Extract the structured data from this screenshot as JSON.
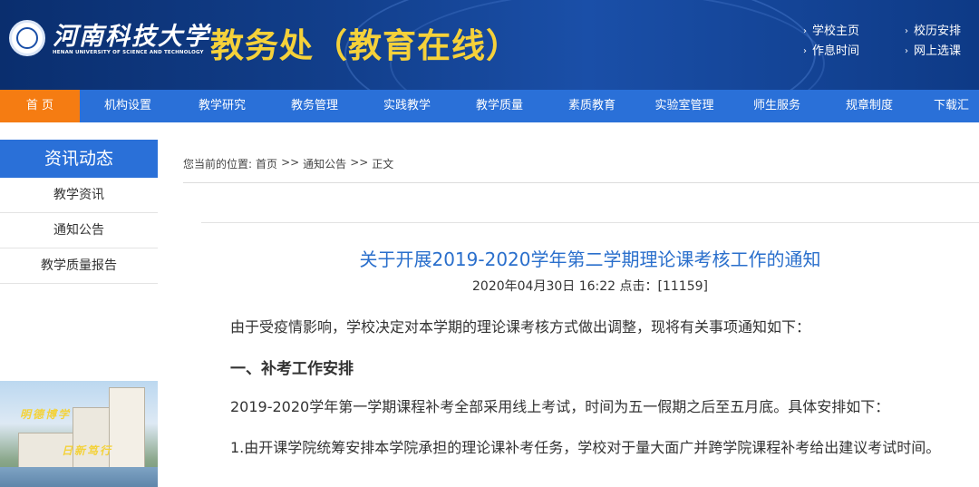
{
  "header": {
    "university_name": "河南科技大学",
    "university_name_en": "HENAN UNIVERSITY OF SCIENCE AND TECHNOLOGY",
    "site_title": "教务处（教育在线）",
    "quick_links": {
      "school_home": "学校主页",
      "calendar": "校历安排",
      "schedule": "作息时间",
      "online_course": "网上选课"
    }
  },
  "nav": {
    "items": [
      "首 页",
      "机构设置",
      "教学研究",
      "教务管理",
      "实践教学",
      "教学质量",
      "素质教育",
      "实验室管理",
      "师生服务",
      "规章制度",
      "下载汇总"
    ],
    "active_index": 0
  },
  "sidebar": {
    "heading": "资讯动态",
    "items": [
      "教学资讯",
      "通知公告",
      "教学质量报告"
    ],
    "banner_text_1": "明德博学",
    "banner_text_2": "日新笃行"
  },
  "breadcrumb": {
    "prefix": "您当前的位置:",
    "home": "首页",
    "sep": ">>",
    "category": "通知公告",
    "current": "正文"
  },
  "article": {
    "title": "关于开展2019-2020学年第二学期理论课考核工作的通知",
    "meta": "2020年04月30日 16:22  点击：[11159]",
    "paragraph_1": "由于受疫情影响，学校决定对本学期的理论课考核方式做出调整，现将有关事项通知如下：",
    "section_1_heading": "一、补考工作安排",
    "paragraph_2": "2019-2020学年第一学期课程补考全部采用线上考试，时间为五一假期之后至五月底。具体安排如下：",
    "paragraph_3": "1.由开课学院统筹安排本学院承担的理论课补考任务，学校对于量大面广并跨学院课程补考给出建议考试时间。"
  },
  "colors": {
    "nav_blue": "#2a70d8",
    "nav_active": "#f57c12",
    "title_blue": "#2a6fcc",
    "header_gold": "#f5d13a"
  }
}
